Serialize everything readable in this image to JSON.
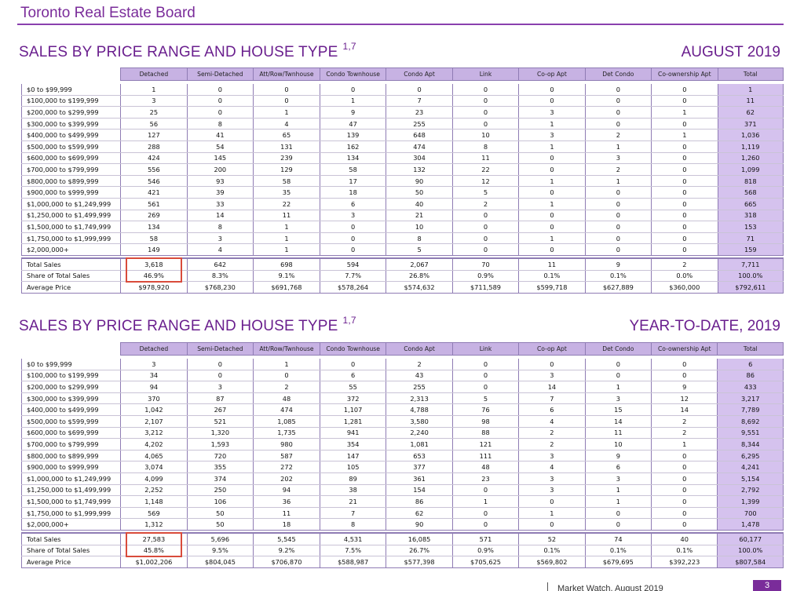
{
  "header": {
    "title": "Toronto Real Estate Board"
  },
  "columns": [
    "Detached",
    "Semi-Detached",
    "Att/Row/Twnhouse",
    "Condo Townhouse",
    "Condo Apt",
    "Link",
    "Co-op Apt",
    "Det Condo",
    "Co-ownership Apt",
    "Total"
  ],
  "sections": [
    {
      "title": "SALES BY PRICE RANGE AND HOUSE TYPE",
      "superscript": "1,7",
      "period": "AUGUST 2019",
      "rows": [
        {
          "label": "$0 to $99,999",
          "values": [
            "1",
            "0",
            "0",
            "0",
            "0",
            "0",
            "0",
            "0",
            "0",
            "1"
          ]
        },
        {
          "label": "$100,000 to $199,999",
          "values": [
            "3",
            "0",
            "0",
            "1",
            "7",
            "0",
            "0",
            "0",
            "0",
            "11"
          ]
        },
        {
          "label": "$200,000 to $299,999",
          "values": [
            "25",
            "0",
            "1",
            "9",
            "23",
            "0",
            "3",
            "0",
            "1",
            "62"
          ]
        },
        {
          "label": "$300,000 to $399,999",
          "values": [
            "56",
            "8",
            "4",
            "47",
            "255",
            "0",
            "1",
            "0",
            "0",
            "371"
          ]
        },
        {
          "label": "$400,000 to $499,999",
          "values": [
            "127",
            "41",
            "65",
            "139",
            "648",
            "10",
            "3",
            "2",
            "1",
            "1,036"
          ]
        },
        {
          "label": "$500,000 to $599,999",
          "values": [
            "288",
            "54",
            "131",
            "162",
            "474",
            "8",
            "1",
            "1",
            "0",
            "1,119"
          ]
        },
        {
          "label": "$600,000 to $699,999",
          "values": [
            "424",
            "145",
            "239",
            "134",
            "304",
            "11",
            "0",
            "3",
            "0",
            "1,260"
          ]
        },
        {
          "label": "$700,000 to $799,999",
          "values": [
            "556",
            "200",
            "129",
            "58",
            "132",
            "22",
            "0",
            "2",
            "0",
            "1,099"
          ]
        },
        {
          "label": "$800,000 to $899,999",
          "values": [
            "546",
            "93",
            "58",
            "17",
            "90",
            "12",
            "1",
            "1",
            "0",
            "818"
          ]
        },
        {
          "label": "$900,000 to $999,999",
          "values": [
            "421",
            "39",
            "35",
            "18",
            "50",
            "5",
            "0",
            "0",
            "0",
            "568"
          ]
        },
        {
          "label": "$1,000,000 to $1,249,999",
          "values": [
            "561",
            "33",
            "22",
            "6",
            "40",
            "2",
            "1",
            "0",
            "0",
            "665"
          ]
        },
        {
          "label": "$1,250,000 to $1,499,999",
          "values": [
            "269",
            "14",
            "11",
            "3",
            "21",
            "0",
            "0",
            "0",
            "0",
            "318"
          ]
        },
        {
          "label": "$1,500,000 to $1,749,999",
          "values": [
            "134",
            "8",
            "1",
            "0",
            "10",
            "0",
            "0",
            "0",
            "0",
            "153"
          ]
        },
        {
          "label": "$1,750,000 to $1,999,999",
          "values": [
            "58",
            "3",
            "1",
            "0",
            "8",
            "0",
            "1",
            "0",
            "0",
            "71"
          ]
        },
        {
          "label": "$2,000,000+",
          "values": [
            "149",
            "4",
            "1",
            "0",
            "5",
            "0",
            "0",
            "0",
            "0",
            "159"
          ]
        }
      ],
      "summary": [
        {
          "label": "Total Sales",
          "values": [
            "3,618",
            "642",
            "698",
            "594",
            "2,067",
            "70",
            "11",
            "9",
            "2",
            "7,711"
          ]
        },
        {
          "label": "Share of Total Sales",
          "values": [
            "46.9%",
            "8.3%",
            "9.1%",
            "7.7%",
            "26.8%",
            "0.9%",
            "0.1%",
            "0.1%",
            "0.0%",
            "100.0%"
          ]
        },
        {
          "label": "Average Price",
          "values": [
            "$978,920",
            "$768,230",
            "$691,768",
            "$578,264",
            "$574,632",
            "$711,589",
            "$599,718",
            "$627,889",
            "$360,000",
            "$792,611"
          ]
        }
      ]
    },
    {
      "title": "SALES BY PRICE RANGE AND HOUSE TYPE",
      "superscript": "1,7",
      "period": "YEAR-TO-DATE, 2019",
      "rows": [
        {
          "label": "$0 to $99,999",
          "values": [
            "3",
            "0",
            "1",
            "0",
            "2",
            "0",
            "0",
            "0",
            "0",
            "6"
          ]
        },
        {
          "label": "$100,000 to $199,999",
          "values": [
            "34",
            "0",
            "0",
            "6",
            "43",
            "0",
            "3",
            "0",
            "0",
            "86"
          ]
        },
        {
          "label": "$200,000 to $299,999",
          "values": [
            "94",
            "3",
            "2",
            "55",
            "255",
            "0",
            "14",
            "1",
            "9",
            "433"
          ]
        },
        {
          "label": "$300,000 to $399,999",
          "values": [
            "370",
            "87",
            "48",
            "372",
            "2,313",
            "5",
            "7",
            "3",
            "12",
            "3,217"
          ]
        },
        {
          "label": "$400,000 to $499,999",
          "values": [
            "1,042",
            "267",
            "474",
            "1,107",
            "4,788",
            "76",
            "6",
            "15",
            "14",
            "7,789"
          ]
        },
        {
          "label": "$500,000 to $599,999",
          "values": [
            "2,107",
            "521",
            "1,085",
            "1,281",
            "3,580",
            "98",
            "4",
            "14",
            "2",
            "8,692"
          ]
        },
        {
          "label": "$600,000 to $699,999",
          "values": [
            "3,212",
            "1,320",
            "1,735",
            "941",
            "2,240",
            "88",
            "2",
            "11",
            "2",
            "9,551"
          ]
        },
        {
          "label": "$700,000 to $799,999",
          "values": [
            "4,202",
            "1,593",
            "980",
            "354",
            "1,081",
            "121",
            "2",
            "10",
            "1",
            "8,344"
          ]
        },
        {
          "label": "$800,000 to $899,999",
          "values": [
            "4,065",
            "720",
            "587",
            "147",
            "653",
            "111",
            "3",
            "9",
            "0",
            "6,295"
          ]
        },
        {
          "label": "$900,000 to $999,999",
          "values": [
            "3,074",
            "355",
            "272",
            "105",
            "377",
            "48",
            "4",
            "6",
            "0",
            "4,241"
          ]
        },
        {
          "label": "$1,000,000 to $1,249,999",
          "values": [
            "4,099",
            "374",
            "202",
            "89",
            "361",
            "23",
            "3",
            "3",
            "0",
            "5,154"
          ]
        },
        {
          "label": "$1,250,000 to $1,499,999",
          "values": [
            "2,252",
            "250",
            "94",
            "38",
            "154",
            "0",
            "3",
            "1",
            "0",
            "2,792"
          ]
        },
        {
          "label": "$1,500,000 to $1,749,999",
          "values": [
            "1,148",
            "106",
            "36",
            "21",
            "86",
            "1",
            "0",
            "1",
            "0",
            "1,399"
          ]
        },
        {
          "label": "$1,750,000 to $1,999,999",
          "values": [
            "569",
            "50",
            "11",
            "7",
            "62",
            "0",
            "1",
            "0",
            "0",
            "700"
          ]
        },
        {
          "label": "$2,000,000+",
          "values": [
            "1,312",
            "50",
            "18",
            "8",
            "90",
            "0",
            "0",
            "0",
            "0",
            "1,478"
          ]
        }
      ],
      "summary": [
        {
          "label": "Total Sales",
          "values": [
            "27,583",
            "5,696",
            "5,545",
            "4,531",
            "16,085",
            "571",
            "52",
            "74",
            "40",
            "60,177"
          ]
        },
        {
          "label": "Share of Total Sales",
          "values": [
            "45.8%",
            "9.5%",
            "9.2%",
            "7.5%",
            "26.7%",
            "0.9%",
            "0.1%",
            "0.1%",
            "0.1%",
            "100.0%"
          ]
        },
        {
          "label": "Average Price",
          "values": [
            "$1,002,206",
            "$804,045",
            "$706,870",
            "$588,987",
            "$577,398",
            "$705,625",
            "$569,802",
            "$679,695",
            "$392,223",
            "$807,584"
          ]
        }
      ]
    }
  ],
  "footer": {
    "text": "Market Watch, August 2019",
    "page": "3"
  },
  "colors": {
    "brand": "#7a2c9a",
    "header_fill": "#c7b2e3",
    "total_fill": "#d5c2ee",
    "highlight": "#d94b3b"
  }
}
